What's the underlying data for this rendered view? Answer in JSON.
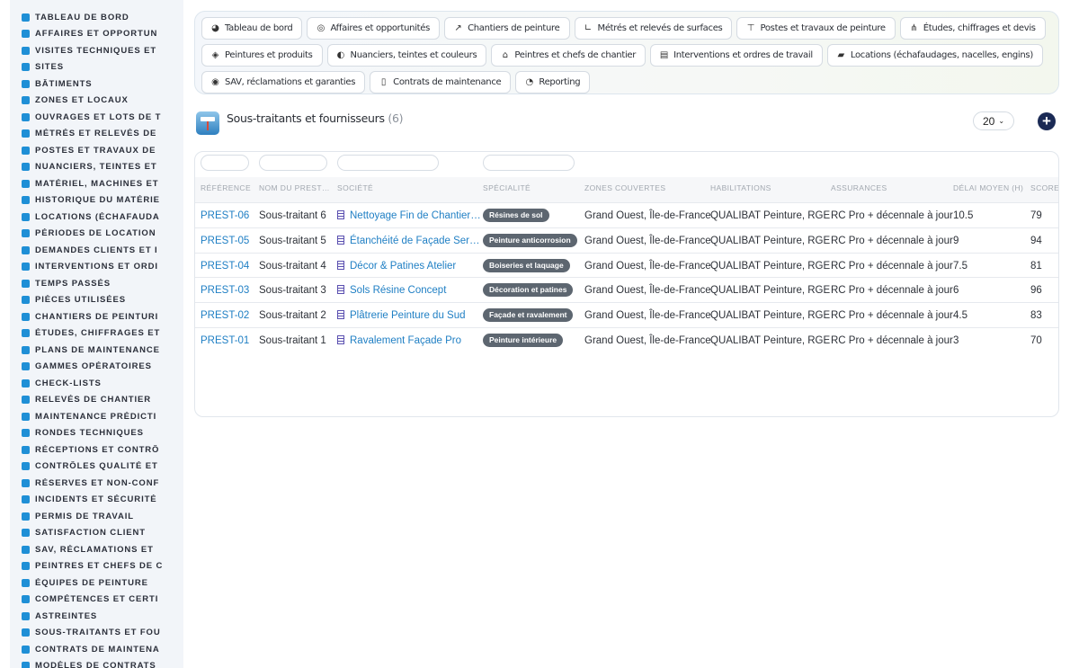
{
  "sidebar": {
    "items": [
      {
        "label": "TABLEAU DE BORD",
        "icon": "dashboard-icon"
      },
      {
        "label": "AFFAIRES ET OPPORTUN",
        "icon": "target-icon"
      },
      {
        "label": "VISITES TECHNIQUES ET",
        "icon": "calendar-icon"
      },
      {
        "label": "SITES",
        "icon": "map-pin-icon"
      },
      {
        "label": "BÂTIMENTS",
        "icon": "building-icon"
      },
      {
        "label": "ZONES ET LOCAUX",
        "icon": "grid-icon"
      },
      {
        "label": "OUVRAGES ET LOTS DE T",
        "icon": "sitemap-icon"
      },
      {
        "label": "MÉTRÉS ET RELEVÉS DE",
        "icon": "ruler-icon"
      },
      {
        "label": "POSTES ET TRAVAUX DE",
        "icon": "paint-roller-icon"
      },
      {
        "label": "NUANCIERS, TEINTES ET",
        "icon": "palette-icon"
      },
      {
        "label": "MATÉRIEL, MACHINES ET",
        "icon": "cogs-icon"
      },
      {
        "label": "HISTORIQUE DU MATÉRIE",
        "icon": "history-icon"
      },
      {
        "label": "LOCATIONS (ÉCHAFAUDA",
        "icon": "truck-icon"
      },
      {
        "label": "PÉRIODES DE LOCATION",
        "icon": "calendar-icon"
      },
      {
        "label": "DEMANDES CLIENTS ET I",
        "icon": "question-icon"
      },
      {
        "label": "INTERVENTIONS ET ORDI",
        "icon": "clipboard-icon"
      },
      {
        "label": "TEMPS PASSÉS",
        "icon": "clock-icon"
      },
      {
        "label": "PIÈCES UTILISÉES",
        "icon": "list-icon"
      },
      {
        "label": "CHANTIERS DE PEINTURI",
        "icon": "hammer-icon"
      },
      {
        "label": "ÉTUDES, CHIFFRAGES ET",
        "icon": "calculator-icon"
      },
      {
        "label": "PLANS DE MAINTENANCE",
        "icon": "calendar-icon"
      },
      {
        "label": "GAMMES OPÉRATOIRES",
        "icon": "list-icon"
      },
      {
        "label": "CHECK-LISTS",
        "icon": "checklist-icon"
      },
      {
        "label": "RELEVÉS DE CHANTIER",
        "icon": "thermometer-icon"
      },
      {
        "label": "MAINTENANCE PRÉDICTI",
        "icon": "chart-icon"
      },
      {
        "label": "RONDES TECHNIQUES",
        "icon": "route-icon"
      },
      {
        "label": "RÉCEPTIONS ET CONTRÔ",
        "icon": "search-icon"
      },
      {
        "label": "CONTRÔLES QUALITÉ ET",
        "icon": "clipboard-check-icon"
      },
      {
        "label": "RÉSERVES ET NON-CONF",
        "icon": "alert-circle-icon"
      },
      {
        "label": "INCIDENTS ET SÉCURITÉ",
        "icon": "warning-icon"
      },
      {
        "label": "PERMIS DE TRAVAIL",
        "icon": "signature-icon"
      },
      {
        "label": "SATISFACTION CLIENT",
        "icon": "smile-icon"
      },
      {
        "label": "SAV, RÉCLAMATIONS ET",
        "icon": "comment-icon"
      },
      {
        "label": "PEINTRES ET CHEFS DE C",
        "icon": "hard-hat-icon"
      },
      {
        "label": "ÉQUIPES DE PEINTURE",
        "icon": "users-icon"
      },
      {
        "label": "COMPÉTENCES ET CERTI",
        "icon": "certificate-icon"
      },
      {
        "label": "ASTREINTES",
        "icon": "phone-icon"
      },
      {
        "label": "SOUS-TRAITANTS ET FOU",
        "icon": "handshake-icon"
      },
      {
        "label": "CONTRATS DE MAINTENA",
        "icon": "file-icon"
      },
      {
        "label": "MODÈLES DE CONTRATS",
        "icon": "file-icon"
      }
    ]
  },
  "topnav": {
    "rows": [
      [
        {
          "label": "Tableau de bord",
          "icon": "dashboard-icon",
          "glyph": "◕"
        },
        {
          "label": "Affaires et opportunités",
          "icon": "target-icon",
          "glyph": "◎"
        },
        {
          "label": "Chantiers de peinture",
          "icon": "hammer-icon",
          "glyph": "↗"
        },
        {
          "label": "Métrés et relevés de surfaces",
          "icon": "ruler-icon",
          "glyph": "∟"
        },
        {
          "label": "Postes et travaux de peinture",
          "icon": "paint-roller-icon",
          "glyph": "⊤"
        },
        {
          "label": "Études, chiffrages et devis",
          "icon": "sitemap-icon",
          "glyph": "⋔"
        }
      ],
      [
        {
          "label": "Peintures et produits",
          "icon": "paint-bucket-icon",
          "glyph": "◈"
        },
        {
          "label": "Nuanciers, teintes et couleurs",
          "icon": "palette-icon",
          "glyph": "◐"
        },
        {
          "label": "Peintres et chefs de chantier",
          "icon": "hard-hat-icon",
          "glyph": "⌂"
        },
        {
          "label": "Interventions et ordres de travail",
          "icon": "clipboard-icon",
          "glyph": "▤"
        },
        {
          "label": "Locations (échafaudages, nacelles, engins)",
          "icon": "truck-icon",
          "glyph": "▰"
        }
      ],
      [
        {
          "label": "SAV, réclamations et garanties",
          "icon": "comment-icon",
          "glyph": "◉"
        },
        {
          "label": "Contrats de maintenance",
          "icon": "file-icon",
          "glyph": "▯"
        },
        {
          "label": "Reporting",
          "icon": "pie-chart-icon",
          "glyph": "◔"
        }
      ]
    ]
  },
  "page": {
    "title": "Sous-traitants et fournisseurs",
    "count": "(6)",
    "per_page": "20",
    "add_icon": "plus-circle-icon"
  },
  "table": {
    "columns": [
      "RÉFÉRENCE",
      "NOM DU PREST…",
      "SOCIÉTÉ",
      "SPÉCIALITÉ",
      "ZONES COUVERTES",
      "HABILITATIONS",
      "ASSURANCES",
      "DÉLAI MOYEN (H)",
      "SCORE"
    ],
    "rows": [
      {
        "ref": "PREST-06",
        "name": "Sous-traitant 6",
        "company": "Nettoyage Fin de Chantier…",
        "specialty": "Résines de sol",
        "zones": "Grand Ouest, Île-de-France",
        "habilitations": "QUALIBAT Peinture, RGE",
        "assurances": "RC Pro + décennale à jour",
        "delai": "10.5",
        "score": "79"
      },
      {
        "ref": "PREST-05",
        "name": "Sous-traitant 5",
        "company": "Étanchéité de Façade Ser…",
        "specialty": "Peinture anticorrosion",
        "zones": "Grand Ouest, Île-de-France",
        "habilitations": "QUALIBAT Peinture, RGE",
        "assurances": "RC Pro + décennale à jour",
        "delai": "9",
        "score": "94"
      },
      {
        "ref": "PREST-04",
        "name": "Sous-traitant 4",
        "company": "Décor & Patines Atelier",
        "specialty": "Boiseries et laquage",
        "zones": "Grand Ouest, Île-de-France",
        "habilitations": "QUALIBAT Peinture, RGE",
        "assurances": "RC Pro + décennale à jour",
        "delai": "7.5",
        "score": "81"
      },
      {
        "ref": "PREST-03",
        "name": "Sous-traitant 3",
        "company": "Sols Résine Concept",
        "specialty": "Décoration et patines",
        "zones": "Grand Ouest, Île-de-France",
        "habilitations": "QUALIBAT Peinture, RGE",
        "assurances": "RC Pro + décennale à jour",
        "delai": "6",
        "score": "96"
      },
      {
        "ref": "PREST-02",
        "name": "Sous-traitant 2",
        "company": "Plâtrerie Peinture du Sud",
        "specialty": "Façade et ravalement",
        "zones": "Grand Ouest, Île-de-France",
        "habilitations": "QUALIBAT Peinture, RGE",
        "assurances": "RC Pro + décennale à jour",
        "delai": "4.5",
        "score": "83"
      },
      {
        "ref": "PREST-01",
        "name": "Sous-traitant 1",
        "company": "Ravalement Façade Pro",
        "specialty": "Peinture intérieure",
        "zones": "Grand Ouest, Île-de-France",
        "habilitations": "QUALIBAT Peinture, RGE",
        "assurances": "RC Pro + décennale à jour",
        "delai": "3",
        "score": "70"
      }
    ]
  },
  "colors": {
    "link": "#1f7fc4",
    "badge": "#5d6670",
    "sidebar_icon": "#1f8fd6",
    "add_button": "#1b2a55"
  }
}
